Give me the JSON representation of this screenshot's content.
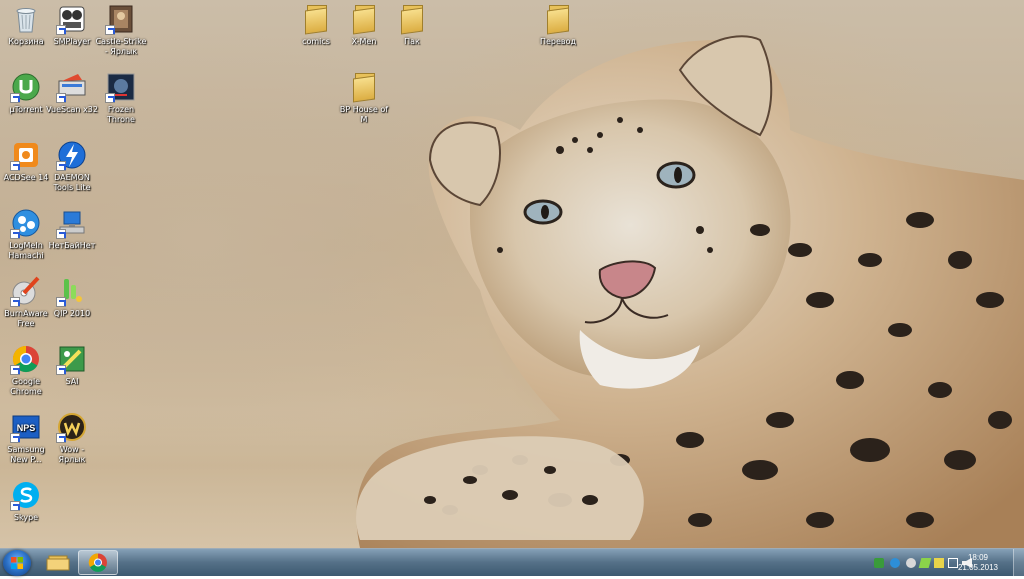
{
  "desktop_icons": [
    {
      "label": "Корзина",
      "icon": "recycle-bin-icon",
      "shortcut": false
    },
    {
      "label": "SMPlayer",
      "icon": "smplayer-icon",
      "shortcut": true
    },
    {
      "label": "Castle-Strike - Ярлык",
      "icon": "castle-strike-icon",
      "shortcut": true
    },
    {
      "label": "µTorrent",
      "icon": "utorrent-icon",
      "shortcut": true
    },
    {
      "label": "VueScan x32",
      "icon": "vuescan-icon",
      "shortcut": true
    },
    {
      "label": "Frozen Throne",
      "icon": "frozen-throne-icon",
      "shortcut": true
    },
    {
      "label": "ACDSee 14",
      "icon": "acdsee-icon",
      "shortcut": true
    },
    {
      "label": "DAEMON Tools Lite",
      "icon": "daemon-tools-icon",
      "shortcut": true
    },
    {
      "label": "LogMeIn Hamachi",
      "icon": "hamachi-icon",
      "shortcut": true
    },
    {
      "label": "НетБайНет",
      "icon": "network-icon",
      "shortcut": true
    },
    {
      "label": "BurnAware Free",
      "icon": "burnaware-icon",
      "shortcut": true
    },
    {
      "label": "QIP 2010",
      "icon": "qip-icon",
      "shortcut": true
    },
    {
      "label": "Google Chrome",
      "icon": "chrome-icon",
      "shortcut": true
    },
    {
      "label": "SAI",
      "icon": "sai-icon",
      "shortcut": true
    },
    {
      "label": "Samsung New P...",
      "icon": "samsung-nps-icon",
      "shortcut": true
    },
    {
      "label": "Wow - Ярлык",
      "icon": "wow-icon",
      "shortcut": true
    },
    {
      "label": "Skype",
      "icon": "skype-icon",
      "shortcut": true
    }
  ],
  "folders": [
    {
      "label": "comics",
      "icon": "folder-icon"
    },
    {
      "label": "X-Men",
      "icon": "folder-icon"
    },
    {
      "label": "Пак",
      "icon": "folder-icon"
    },
    {
      "label": "Перевод",
      "icon": "folder-icon"
    },
    {
      "label": "BP House of M",
      "icon": "folder-icon"
    }
  ],
  "nps_text": "NPS",
  "taskbar": {
    "pinned": [
      {
        "name": "explorer",
        "icon": "folder-icon"
      },
      {
        "name": "chrome",
        "icon": "chrome-icon"
      }
    ],
    "clock": {
      "time": "18:09",
      "date": "21.05.2013"
    }
  },
  "colors": {
    "taskbar": "#4a6a85",
    "folder": "#e8c15a",
    "chrome_red": "#db4437",
    "chrome_green": "#0f9d58",
    "chrome_yellow": "#f4b400",
    "chrome_blue": "#4285f4"
  }
}
